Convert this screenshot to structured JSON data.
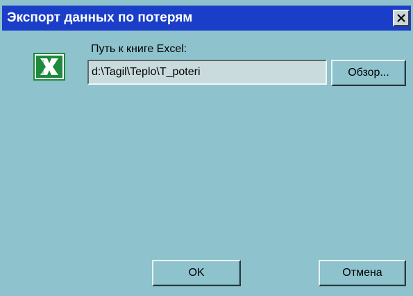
{
  "window": {
    "title": "Экспорт данных по потерям"
  },
  "title_bar": {
    "close_icon": "close-icon",
    "colors": {
      "titlebar": "#1a3ec8",
      "title_text": "#ffffff"
    }
  },
  "form": {
    "icon": "excel-icon",
    "path_label": "Путь к книге Excel:",
    "path_value": "d:\\Tagil\\Teplo\\T_poteri",
    "browse_label": "Обзор..."
  },
  "footer": {
    "ok_label": "OK",
    "cancel_label": "Отмена"
  },
  "colors": {
    "window_bg": "#8ec3cd",
    "input_bg": "#c9dbdd",
    "excel_green": "#1e8a3c"
  }
}
